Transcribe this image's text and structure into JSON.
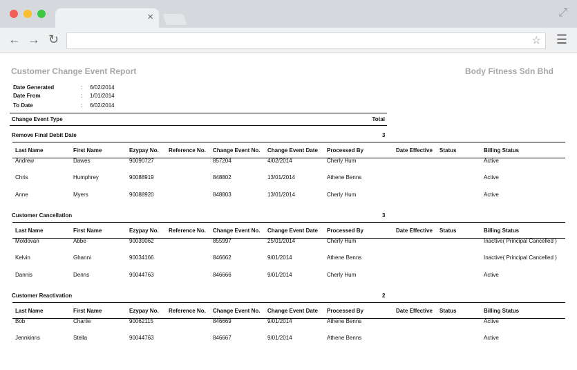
{
  "browser": {
    "tab_close": "×",
    "address": ""
  },
  "report": {
    "title": "Customer Change Event Report",
    "company": "Body Fitness Sdn Bhd",
    "meta": [
      {
        "label": "Date Generated",
        "sep": ":",
        "value": "6/02/2014"
      },
      {
        "label": "Date From",
        "sep": ":",
        "value": "1/01/2014"
      },
      {
        "label": "To Date",
        "sep": ":",
        "value": "6/02/2014"
      }
    ],
    "summary": {
      "label": "Change Event Type",
      "total": "Total"
    },
    "columns": [
      "Last Name",
      "First Name",
      "Ezypay No.",
      "Reference No.",
      "Change Event No.",
      "Change Event Date",
      "Processed By",
      "Date Effective",
      "Status",
      "Billing Status"
    ],
    "sections": [
      {
        "title": "Remove Final Debit Date",
        "count": "3",
        "rows": [
          [
            "Andrew",
            "Dawes",
            "90090727",
            "",
            "857204",
            "4/02/2014",
            "Cherly Hum",
            "",
            "",
            "Active"
          ],
          [
            "Chris",
            "Humphrey",
            "90088919",
            "",
            "848802",
            "13/01/2014",
            "Athene Benns",
            "",
            "",
            "Active"
          ],
          [
            "Anne",
            "Myers",
            "90088920",
            "",
            "848803",
            "13/01/2014",
            "Cherly Hum",
            "",
            "",
            "Active"
          ]
        ]
      },
      {
        "title": "Customer Cancellation",
        "count": "3",
        "rows": [
          [
            "Moldovan",
            "Abbe",
            "90039062",
            "",
            "855997",
            "25/01/2014",
            "Cherly Hum",
            "",
            "",
            "Inactive( Principal Cancelled )"
          ],
          [
            "Kelvin",
            "Ghanni",
            "90034166",
            "",
            "846662",
            "9/01/2014",
            "Athene Benns",
            "",
            "",
            "Inactive( Principal Cancelled )"
          ],
          [
            "Dannis",
            "Denns",
            "90044763",
            "",
            "846666",
            "9/01/2014",
            "Cherly Hum",
            "",
            "",
            "Active"
          ]
        ]
      },
      {
        "title": "Customer Reactivation",
        "count": "2",
        "rows": [
          [
            "Bob",
            "Charlie",
            "90062115",
            "",
            "846669",
            "9/01/2014",
            "Athene Benns",
            "",
            "",
            "Active"
          ],
          [
            "Jennkinns",
            "Stella",
            "90044763",
            "",
            "846667",
            "9/01/2014",
            "Athene Benns",
            "",
            "",
            "Active"
          ]
        ]
      }
    ]
  }
}
